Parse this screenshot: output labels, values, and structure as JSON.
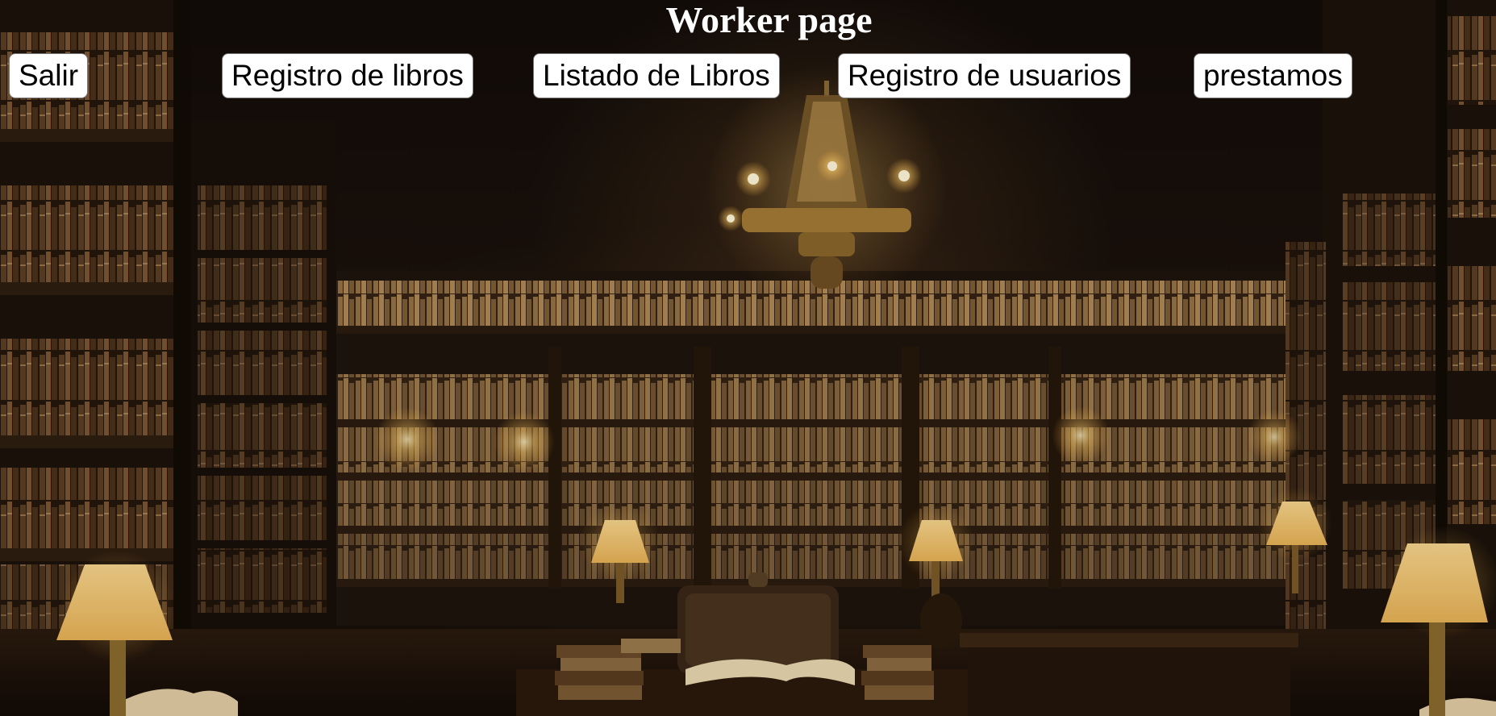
{
  "page": {
    "title": "Worker page"
  },
  "nav": {
    "logout_label": "Salir",
    "register_books_label": "Registro de libros",
    "list_books_label": "Listado de Libros",
    "register_users_label": "Registro de usuarios",
    "loans_label": "prestamos"
  },
  "background": {
    "image": "library-background",
    "colors": {
      "wood_dark": "#1a110b",
      "wood_mid": "#3a2514",
      "book_spine": "#6b4a2a",
      "warm_light": "#ffd98a"
    }
  },
  "icons": {
    "chandelier": "chandelier-icon",
    "lamp": "lamp-icon",
    "open_book": "open-book-icon",
    "chair": "chair-icon"
  }
}
